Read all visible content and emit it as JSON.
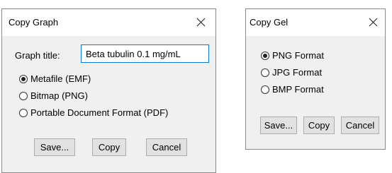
{
  "copy_graph": {
    "title": "Copy Graph",
    "graph_title_label": "Graph title:",
    "graph_title_value": "Beta tubulin 0.1 mg/mL",
    "options": [
      {
        "label": "Metafile (EMF)",
        "selected": true
      },
      {
        "label": "Bitmap (PNG)",
        "selected": false
      },
      {
        "label": "Portable Document Format (PDF)",
        "selected": false
      }
    ],
    "buttons": {
      "save": "Save...",
      "copy": "Copy",
      "cancel": "Cancel"
    }
  },
  "copy_gel": {
    "title": "Copy Gel",
    "options": [
      {
        "label": "PNG Format",
        "selected": true
      },
      {
        "label": "JPG Format",
        "selected": false
      },
      {
        "label": "BMP Format",
        "selected": false
      }
    ],
    "buttons": {
      "save": "Save...",
      "copy": "Copy",
      "cancel": "Cancel"
    }
  },
  "icons": {
    "close": "close-icon",
    "radio_selected": "radio-selected-icon",
    "radio_unselected": "radio-unselected-icon"
  },
  "colors": {
    "dialog_bg": "#f0f0f0",
    "titlebar_bg": "#ffffff",
    "focus_border": "#0a78d7",
    "button_bg": "#e1e1e1"
  }
}
